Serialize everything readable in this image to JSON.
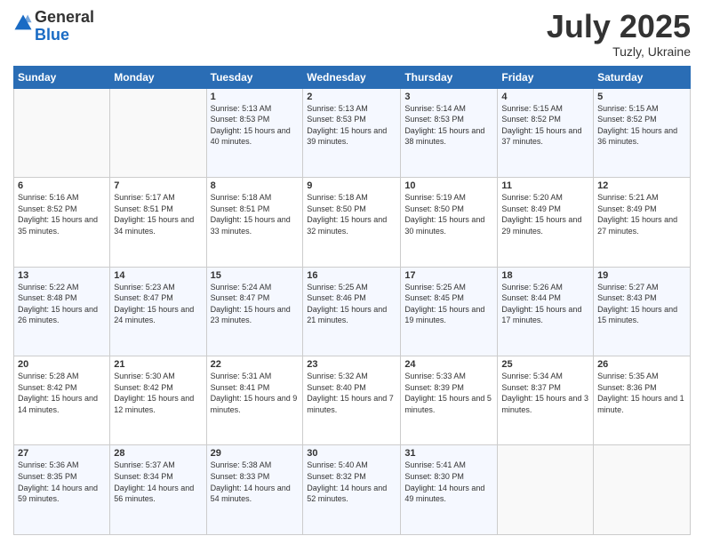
{
  "header": {
    "logo_general": "General",
    "logo_blue": "Blue",
    "month_year": "July 2025",
    "location": "Tuzly, Ukraine"
  },
  "days_of_week": [
    "Sunday",
    "Monday",
    "Tuesday",
    "Wednesday",
    "Thursday",
    "Friday",
    "Saturday"
  ],
  "weeks": [
    [
      {
        "day": "",
        "info": ""
      },
      {
        "day": "",
        "info": ""
      },
      {
        "day": "1",
        "info": "Sunrise: 5:13 AM\nSunset: 8:53 PM\nDaylight: 15 hours and 40 minutes."
      },
      {
        "day": "2",
        "info": "Sunrise: 5:13 AM\nSunset: 8:53 PM\nDaylight: 15 hours and 39 minutes."
      },
      {
        "day": "3",
        "info": "Sunrise: 5:14 AM\nSunset: 8:53 PM\nDaylight: 15 hours and 38 minutes."
      },
      {
        "day": "4",
        "info": "Sunrise: 5:15 AM\nSunset: 8:52 PM\nDaylight: 15 hours and 37 minutes."
      },
      {
        "day": "5",
        "info": "Sunrise: 5:15 AM\nSunset: 8:52 PM\nDaylight: 15 hours and 36 minutes."
      }
    ],
    [
      {
        "day": "6",
        "info": "Sunrise: 5:16 AM\nSunset: 8:52 PM\nDaylight: 15 hours and 35 minutes."
      },
      {
        "day": "7",
        "info": "Sunrise: 5:17 AM\nSunset: 8:51 PM\nDaylight: 15 hours and 34 minutes."
      },
      {
        "day": "8",
        "info": "Sunrise: 5:18 AM\nSunset: 8:51 PM\nDaylight: 15 hours and 33 minutes."
      },
      {
        "day": "9",
        "info": "Sunrise: 5:18 AM\nSunset: 8:50 PM\nDaylight: 15 hours and 32 minutes."
      },
      {
        "day": "10",
        "info": "Sunrise: 5:19 AM\nSunset: 8:50 PM\nDaylight: 15 hours and 30 minutes."
      },
      {
        "day": "11",
        "info": "Sunrise: 5:20 AM\nSunset: 8:49 PM\nDaylight: 15 hours and 29 minutes."
      },
      {
        "day": "12",
        "info": "Sunrise: 5:21 AM\nSunset: 8:49 PM\nDaylight: 15 hours and 27 minutes."
      }
    ],
    [
      {
        "day": "13",
        "info": "Sunrise: 5:22 AM\nSunset: 8:48 PM\nDaylight: 15 hours and 26 minutes."
      },
      {
        "day": "14",
        "info": "Sunrise: 5:23 AM\nSunset: 8:47 PM\nDaylight: 15 hours and 24 minutes."
      },
      {
        "day": "15",
        "info": "Sunrise: 5:24 AM\nSunset: 8:47 PM\nDaylight: 15 hours and 23 minutes."
      },
      {
        "day": "16",
        "info": "Sunrise: 5:25 AM\nSunset: 8:46 PM\nDaylight: 15 hours and 21 minutes."
      },
      {
        "day": "17",
        "info": "Sunrise: 5:25 AM\nSunset: 8:45 PM\nDaylight: 15 hours and 19 minutes."
      },
      {
        "day": "18",
        "info": "Sunrise: 5:26 AM\nSunset: 8:44 PM\nDaylight: 15 hours and 17 minutes."
      },
      {
        "day": "19",
        "info": "Sunrise: 5:27 AM\nSunset: 8:43 PM\nDaylight: 15 hours and 15 minutes."
      }
    ],
    [
      {
        "day": "20",
        "info": "Sunrise: 5:28 AM\nSunset: 8:42 PM\nDaylight: 15 hours and 14 minutes."
      },
      {
        "day": "21",
        "info": "Sunrise: 5:30 AM\nSunset: 8:42 PM\nDaylight: 15 hours and 12 minutes."
      },
      {
        "day": "22",
        "info": "Sunrise: 5:31 AM\nSunset: 8:41 PM\nDaylight: 15 hours and 9 minutes."
      },
      {
        "day": "23",
        "info": "Sunrise: 5:32 AM\nSunset: 8:40 PM\nDaylight: 15 hours and 7 minutes."
      },
      {
        "day": "24",
        "info": "Sunrise: 5:33 AM\nSunset: 8:39 PM\nDaylight: 15 hours and 5 minutes."
      },
      {
        "day": "25",
        "info": "Sunrise: 5:34 AM\nSunset: 8:37 PM\nDaylight: 15 hours and 3 minutes."
      },
      {
        "day": "26",
        "info": "Sunrise: 5:35 AM\nSunset: 8:36 PM\nDaylight: 15 hours and 1 minute."
      }
    ],
    [
      {
        "day": "27",
        "info": "Sunrise: 5:36 AM\nSunset: 8:35 PM\nDaylight: 14 hours and 59 minutes."
      },
      {
        "day": "28",
        "info": "Sunrise: 5:37 AM\nSunset: 8:34 PM\nDaylight: 14 hours and 56 minutes."
      },
      {
        "day": "29",
        "info": "Sunrise: 5:38 AM\nSunset: 8:33 PM\nDaylight: 14 hours and 54 minutes."
      },
      {
        "day": "30",
        "info": "Sunrise: 5:40 AM\nSunset: 8:32 PM\nDaylight: 14 hours and 52 minutes."
      },
      {
        "day": "31",
        "info": "Sunrise: 5:41 AM\nSunset: 8:30 PM\nDaylight: 14 hours and 49 minutes."
      },
      {
        "day": "",
        "info": ""
      },
      {
        "day": "",
        "info": ""
      }
    ]
  ]
}
